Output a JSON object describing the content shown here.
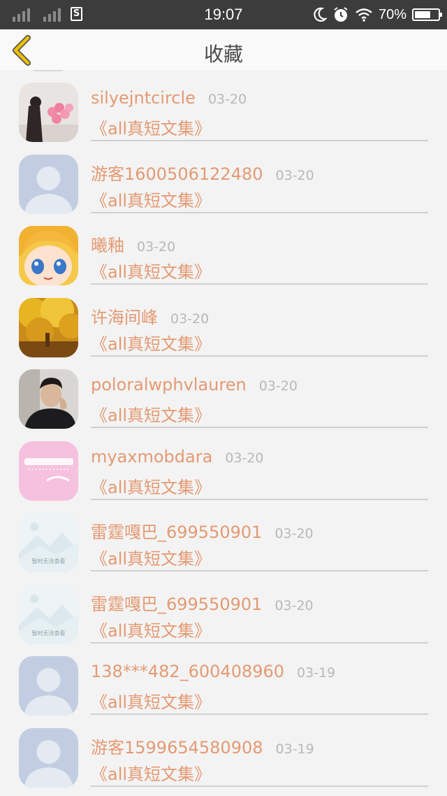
{
  "status_bar": {
    "time": "19:07",
    "sim_label": "S",
    "battery_text": "70%",
    "battery_level": 0.7,
    "icons": [
      "signal-icon",
      "sim-icon",
      "moon-icon",
      "alarm-icon",
      "wifi-icon",
      "battery-icon"
    ]
  },
  "header": {
    "title": "收藏",
    "back_icon": "chevron-left-icon",
    "accent_color": "#f0b400"
  },
  "list": {
    "items": [
      {
        "name": "silyejntcircle",
        "date": "03-20",
        "title": "《all真短文集》",
        "avatar": "girl-balloons"
      },
      {
        "name": "游客1600506122480",
        "date": "03-20",
        "title": "《all真短文集》",
        "avatar": "default-person"
      },
      {
        "name": "曦釉",
        "date": "03-20",
        "title": "《all真短文集》",
        "avatar": "anime-girl"
      },
      {
        "name": "许海间峰",
        "date": "03-20",
        "title": "《all真短文集》",
        "avatar": "autumn-tree"
      },
      {
        "name": "poloralwphvlauren",
        "date": "03-20",
        "title": "《all真短文集》",
        "avatar": "man-photo"
      },
      {
        "name": "myaxmobdara",
        "date": "03-20",
        "title": "《all真短文集》",
        "avatar": "pink-smile"
      },
      {
        "name": "雷霆嘎巴_699550901",
        "date": "03-20",
        "title": "《all真短文集》",
        "avatar": "image-unavailable",
        "avatar_text": "暂时无法查看"
      },
      {
        "name": "雷霆嘎巴_699550901",
        "date": "03-20",
        "title": "《all真短文集》",
        "avatar": "image-unavailable",
        "avatar_text": "暂时无法查看"
      },
      {
        "name": "138***482_600408960",
        "date": "03-19",
        "title": "《all真短文集》",
        "avatar": "default-person"
      },
      {
        "name": "游客1599654580908",
        "date": "03-19",
        "title": "《all真短文集》",
        "avatar": "default-person"
      }
    ]
  },
  "colors": {
    "status_bar_bg": "#3c3c3c",
    "username": "#e49a73",
    "date": "#b8b8b8",
    "background": "#f3f3f3"
  }
}
